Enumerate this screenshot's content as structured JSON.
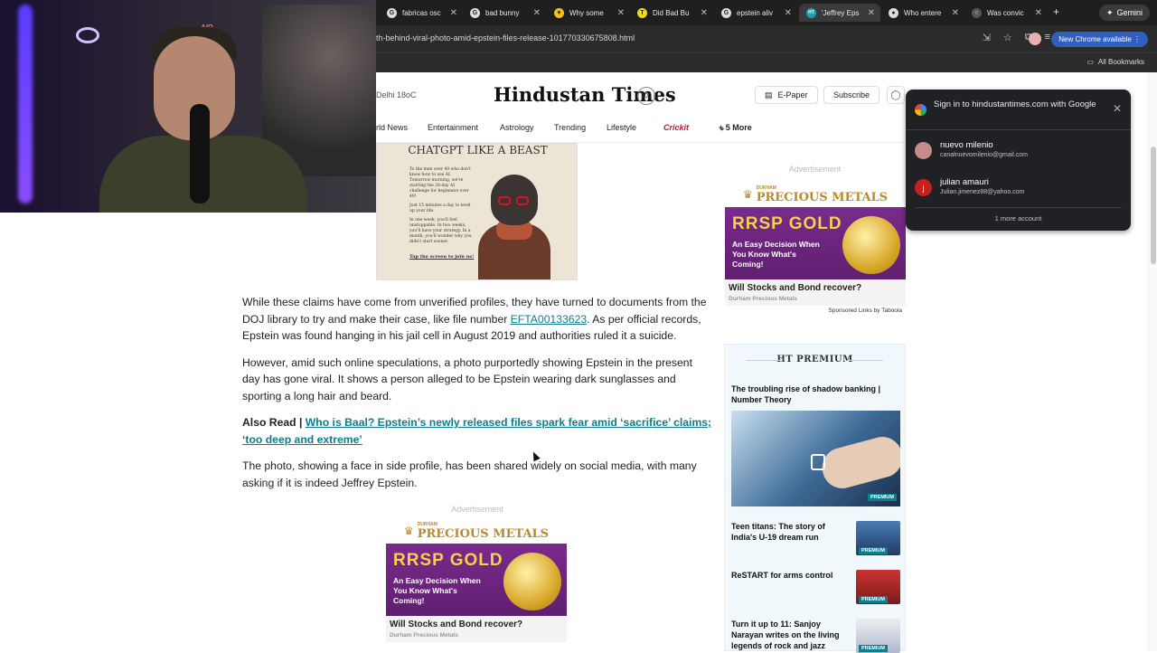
{
  "browser": {
    "tabs": [
      {
        "label": "fabricas osc",
        "fav": "G",
        "active": false
      },
      {
        "label": "bad bunny",
        "fav": "G",
        "active": false
      },
      {
        "label": "Why some",
        "fav": "♥",
        "active": false
      },
      {
        "label": "Did Bad Bu",
        "fav": "T",
        "active": false
      },
      {
        "label": "epstein aliv",
        "fav": "G",
        "active": false
      },
      {
        "label": "'Jeffrey Eps",
        "fav": "HT",
        "active": true
      },
      {
        "label": "Who entere",
        "fav": "●",
        "active": false
      },
      {
        "label": "Was convic",
        "fav": "○",
        "active": false
      }
    ],
    "new_tab": "+",
    "gemini_label": "Gemini",
    "url": "th-behind-viral-photo-amid-epstein-files-release-101770330675808.html",
    "new_chrome_label": "New Chrome available",
    "all_bookmarks": "All Bookmarks"
  },
  "webcam": {
    "onair": "AIR"
  },
  "site": {
    "weather": "Delhi 18oC",
    "logo": "Hindustan Times",
    "logo_badge": "100",
    "epaper": "E-Paper",
    "subscribe": "Subscribe",
    "nav": [
      "rld News",
      "Entertainment",
      "Astrology",
      "Trending",
      "Lifestyle",
      "Crickit",
      "+ 5 More"
    ]
  },
  "promo_image": {
    "headline": "CHATGPT LIKE A BEAST",
    "lines": [
      "To the men over 40 who don't know how to use AI. Tomorrow morning, we're starting the 28-day AI challenge for beginners over 40!",
      "Just 15 minutes a day to level up your life.",
      "In one week, you'll feel unstoppable. In two weeks, you'll have your strategy. In a month, you'll wonder why you didn't start sooner.",
      "Tap the screen to join us!"
    ]
  },
  "article": {
    "p1_before": "While these claims have come from unverified profiles, they have turned to documents from the DOJ library to try and make their case, like file number ",
    "p1_link": "EFTA00133623",
    "p1_after": ". As per official records, Epstein was found hanging in his jail cell in August 2019 and authorities ruled it a suicide.",
    "p2": "However, amid such online speculations, a photo purportedly showing Epstein in the present day has gone viral. It shows a person alleged to be Epstein wearing dark sunglasses and sporting a long hair and beard.",
    "also_read_label": "Also Read | ",
    "also_read_link": "Who is Baal? Epstein’s newly released files spark fear amid ‘sacrifice’ claims; ‘too deep and extreme’",
    "p3": "The photo, showing a face in side profile, has been shared widely on social media, with many asking if it is indeed Jeffrey Epstein.",
    "ad_label": "Advertisement"
  },
  "ad": {
    "brand_small": "DURHAM",
    "brand_big": "PRECIOUS METALS",
    "headline": "RRSP GOLD",
    "sub": "An Easy Decision When You Know What's Coming!",
    "title": "Will Stocks and Bond recover?",
    "source": "Durham Precious Metals",
    "sponsored": "Sponsored Links by Taboola",
    "label": "Advertisement"
  },
  "premium": {
    "heading": "HT PREMIUM",
    "lead": "The troubling rise of shadow banking | Number Theory",
    "badge": "PREMIUM",
    "stories": [
      "Teen titans: The story of India's U-19 dream run",
      "ReSTART for arms control",
      "Turn it up to 11: Sanjoy Narayan writes on the living legends of rock and jazz"
    ]
  },
  "signin": {
    "header": "Sign in to hindustantimes.com with Google",
    "accounts": [
      {
        "name": "nuevo milenio",
        "email": "canalnuevomilenio@gmail.com",
        "initial": "",
        "color": "#c98a8a"
      },
      {
        "name": "julian amauri",
        "email": "Julian.jimenez88@yahoo.com",
        "initial": "j",
        "color": "#c5221f"
      }
    ],
    "more": "1 more account"
  }
}
